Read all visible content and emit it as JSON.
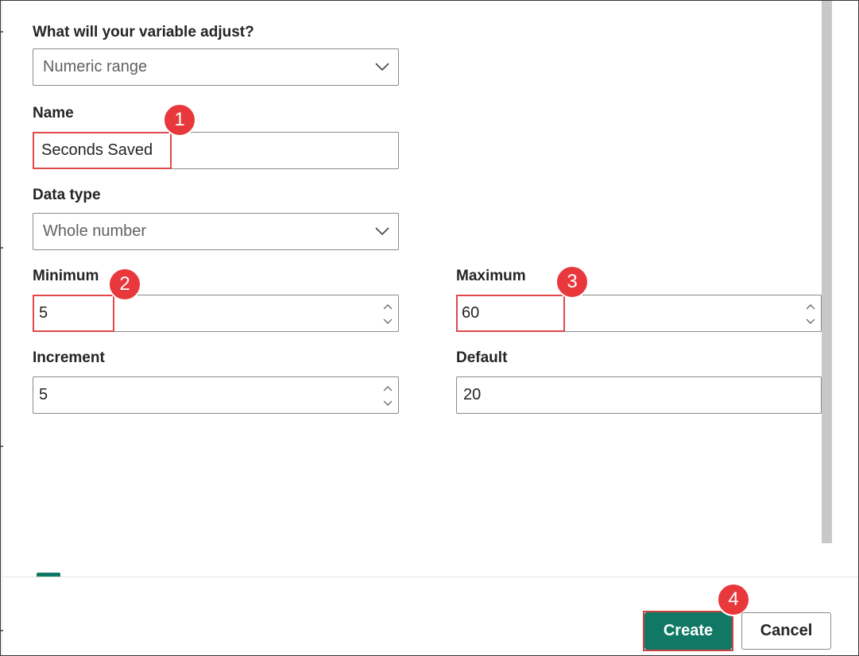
{
  "form": {
    "adjust_label": "What will your variable adjust?",
    "adjust_value": "Numeric range",
    "name_label": "Name",
    "name_value": "Seconds Saved",
    "datatype_label": "Data type",
    "datatype_value": "Whole number",
    "minimum_label": "Minimum",
    "minimum_value": "5",
    "maximum_label": "Maximum",
    "maximum_value": "60",
    "increment_label": "Increment",
    "increment_value": "5",
    "default_label": "Default",
    "default_value": "20"
  },
  "annotations": {
    "step1": "1",
    "step2": "2",
    "step3": "3",
    "step4": "4",
    "color": "#e8383c"
  },
  "footer": {
    "create_label": "Create",
    "cancel_label": "Cancel",
    "accent_color": "#117865"
  },
  "icons": {
    "dropdown": "chevron-down-icon",
    "spinner": "spinner-arrows-icon"
  }
}
